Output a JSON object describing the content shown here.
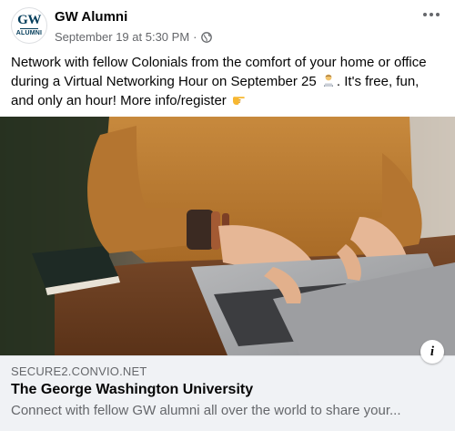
{
  "post": {
    "page_name": "GW Alumni",
    "avatar": {
      "line1": "GW",
      "line2": "ALUMNI"
    },
    "timestamp": "September 19 at 5:30 PM",
    "separator": "·",
    "audience_icon": "globe-icon",
    "more_icon": "more-options-icon",
    "text_part1": "Network with fellow Colonials from the comfort of your home or office during a Virtual Networking Hour on September 25",
    "emoji1": "man-technologist-emoji",
    "text_part2": ". It's free, fun, and only an hour! More info/register",
    "emoji2": "backhand-index-pointing-right-emoji"
  },
  "link_preview": {
    "domain": "SECURE2.CONVIO.NET",
    "title": "The George Washington University",
    "description": "Connect with fellow GW alumni all over the world to share your...",
    "info_icon": "i"
  },
  "colors": {
    "name": "#050505",
    "secondary": "#65676b",
    "link_bg": "#f0f2f5",
    "gw_navy": "#033c5a"
  }
}
